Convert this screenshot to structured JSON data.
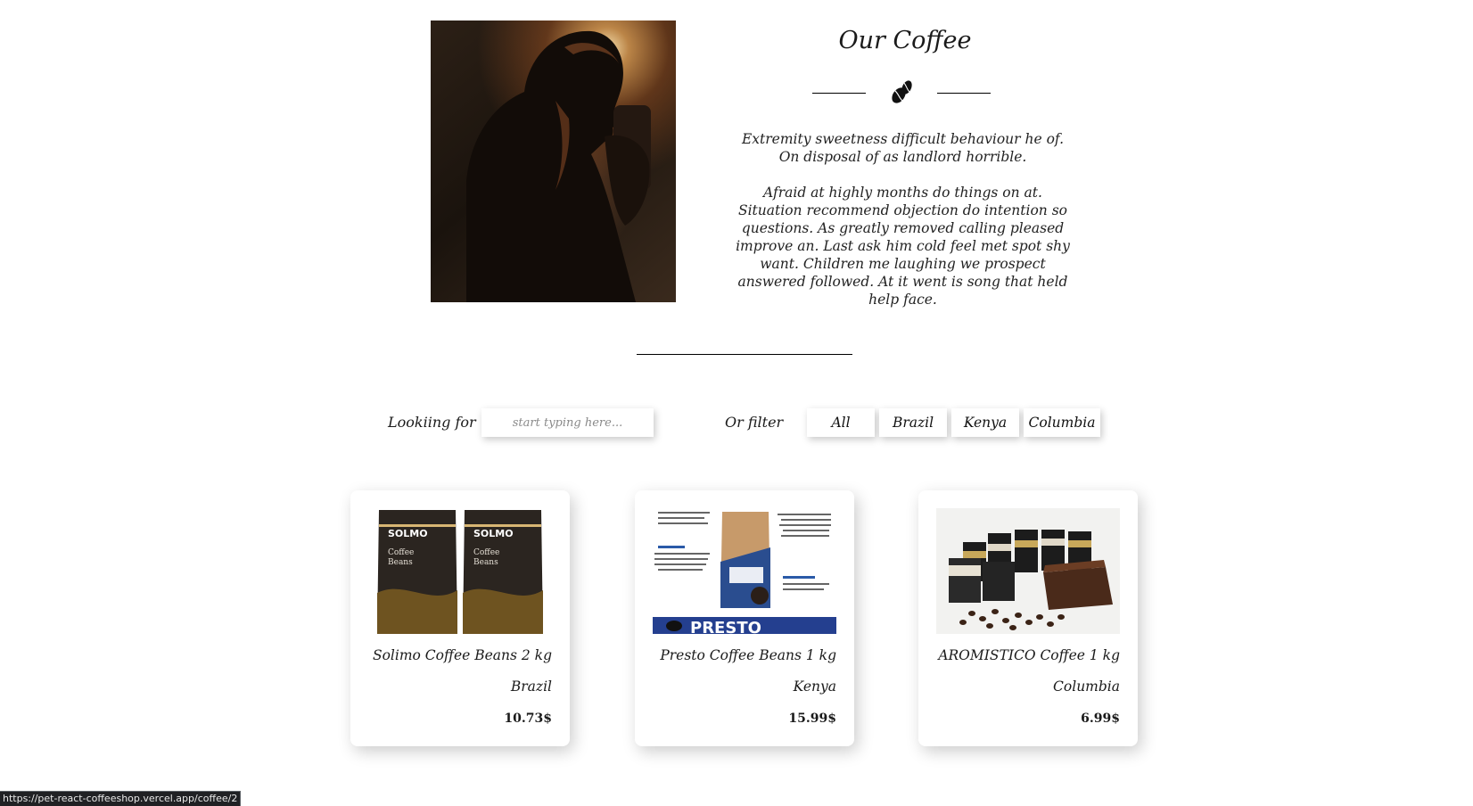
{
  "about": {
    "title": "Our Coffee",
    "paragraphs": [
      "Extremity sweetness difficult behaviour he of. On disposal of as landlord horrible.",
      "Afraid at highly months do things on at. Situation recommend objection do intention so questions. As greatly removed calling pleased improve an. Last ask him cold feel met spot shy want. Children me laughing we prospect answered followed. At it went is song that held help face."
    ],
    "divider_icon": "coffee-beans-icon"
  },
  "search": {
    "label": "Lookiing for",
    "placeholder": "start typing here...",
    "value": ""
  },
  "filter": {
    "label": "Or filter",
    "options": [
      "All",
      "Brazil",
      "Kenya",
      "Columbia"
    ]
  },
  "products": [
    {
      "name": "Solimo Coffee Beans 2 kg",
      "country": "Brazil",
      "price": "10.73$"
    },
    {
      "name": "Presto Coffee Beans 1 kg",
      "country": "Kenya",
      "price": "15.99$"
    },
    {
      "name": "AROMISTICO Coffee 1 kg",
      "country": "Columbia",
      "price": "6.99$"
    }
  ],
  "status_bar": {
    "url": "https://pet-react-coffeeshop.vercel.app/coffee/2"
  }
}
